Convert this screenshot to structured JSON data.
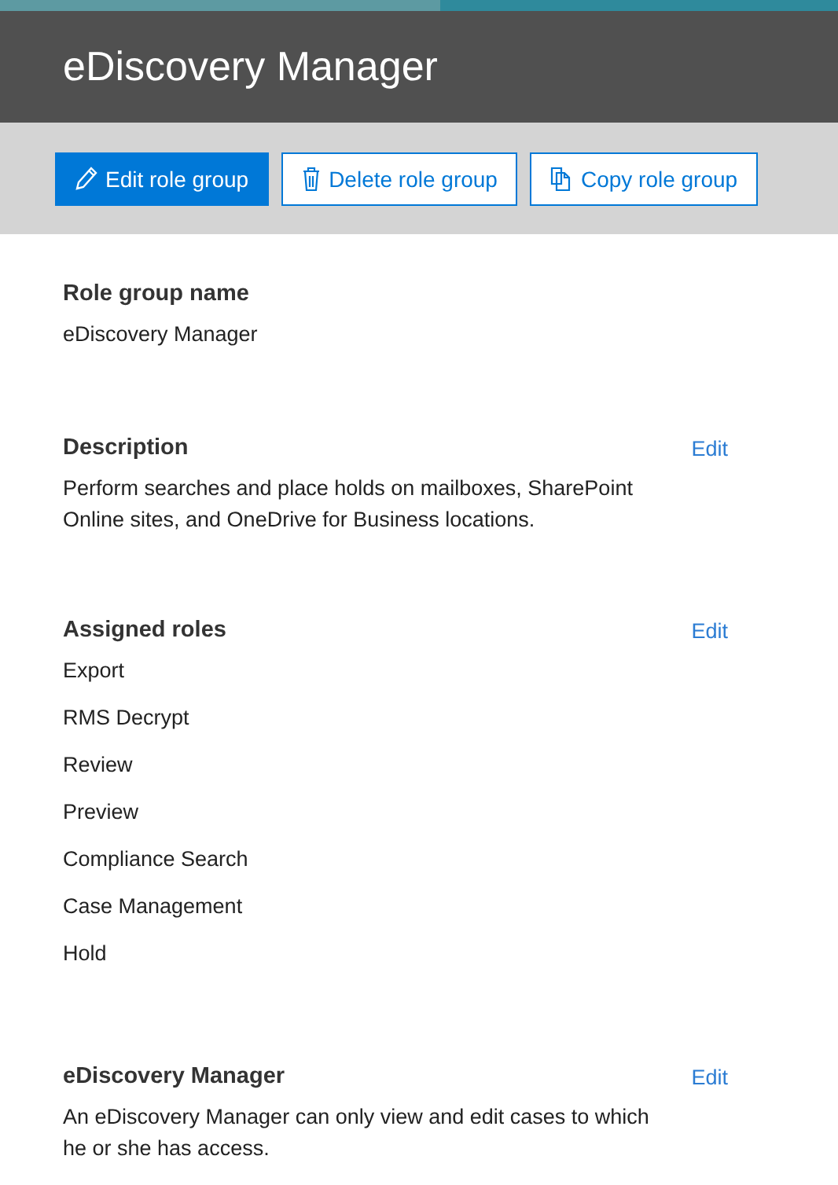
{
  "header": {
    "title": "eDiscovery Manager"
  },
  "toolbar": [
    {
      "label": "Edit role group",
      "kind": "edit",
      "primary": true
    },
    {
      "label": "Delete role group",
      "kind": "delete",
      "primary": false
    },
    {
      "label": "Copy role group",
      "kind": "copy",
      "primary": false
    }
  ],
  "sections": [
    {
      "heading": "Role group name",
      "lines": [
        "eDiscovery Manager"
      ]
    },
    {
      "heading": "Description",
      "edit": "Edit",
      "text": "Perform searches and place holds on mailboxes, SharePoint Online sites, and OneDrive for Business locations."
    },
    {
      "heading": "Assigned roles",
      "edit": "Edit",
      "lines": [
        "Export",
        "RMS Decrypt",
        "Review",
        "Preview",
        "Compliance Search",
        "Case Management",
        "Hold"
      ]
    },
    {
      "heading": "eDiscovery Manager",
      "edit": "Edit",
      "text": "An eDiscovery Manager can only view and edit cases to which he or she has access."
    }
  ]
}
